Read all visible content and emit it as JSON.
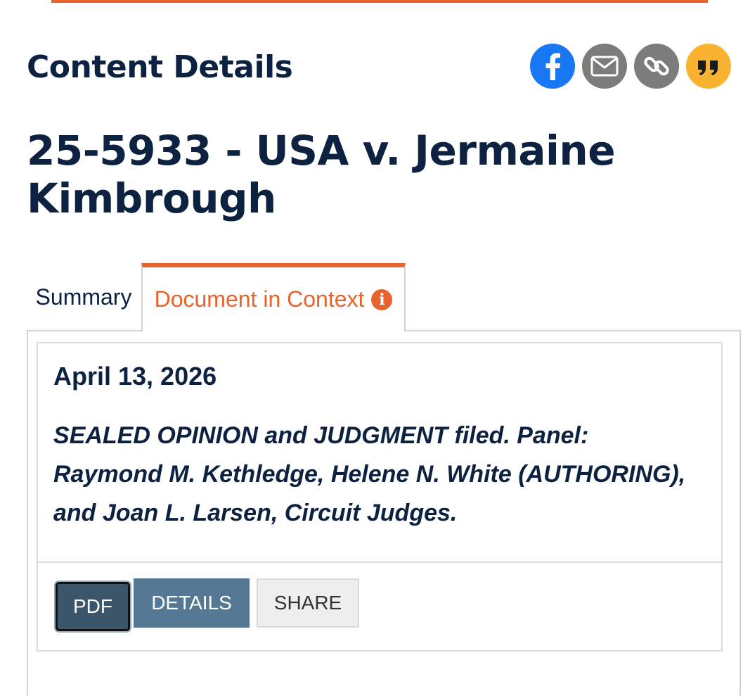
{
  "header": {
    "title": "Content Details"
  },
  "share_icons": [
    {
      "name": "facebook-icon",
      "color": "#1877f2"
    },
    {
      "name": "email-icon",
      "color": "#7c7c7c"
    },
    {
      "name": "link-icon",
      "color": "#7c7c7c"
    },
    {
      "name": "quote-icon",
      "color": "#f9b330"
    }
  ],
  "case": {
    "title": "25-5933 - USA v. Jermaine Kimbrough"
  },
  "tabs": [
    {
      "label": "Summary",
      "active": false
    },
    {
      "label": "Document in Context",
      "active": true
    }
  ],
  "entry": {
    "date": "April 13, 2026",
    "text": "SEALED OPINION and JUDGMENT filed. Panel: Raymond M. Kethledge, Helene N. White (AUTHORING), and Joan L. Larsen, Circuit Judges."
  },
  "buttons": {
    "pdf": "PDF",
    "details": "DETAILS",
    "share": "SHARE"
  },
  "colors": {
    "accent": "#e8632b",
    "navy": "#0d2240",
    "details_button": "#557894"
  }
}
